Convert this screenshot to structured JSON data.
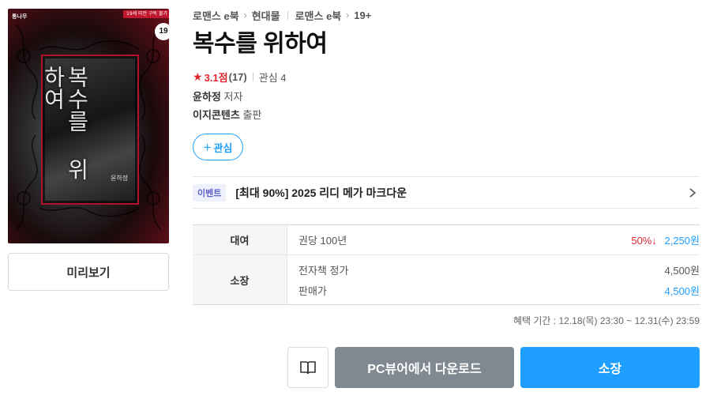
{
  "cover": {
    "title_art": "복수를 위하여",
    "author_art": "윤하정",
    "publisher_mark": "통나무",
    "ribbon": "19세 미만 구독 불가",
    "age_badge": "19"
  },
  "preview_button": "미리보기",
  "breadcrumb": {
    "items": [
      "로맨스 e북",
      "현대물",
      "로맨스 e북",
      "19+"
    ]
  },
  "title": "복수를 위하여",
  "rating": {
    "score": "3.1점",
    "count": "(17)",
    "interest": "관심 4"
  },
  "author": {
    "name": "윤하정",
    "role": "저자"
  },
  "publisher": {
    "name": "이지콘텐츠",
    "role": "출판"
  },
  "follow_button": {
    "plus": "+",
    "label": "관심"
  },
  "event": {
    "badge": "이벤트",
    "text": "[최대 90%] 2025 리디 메가 마크다운"
  },
  "pricing": {
    "rental": {
      "label": "대여",
      "desc": "권당 100년",
      "discount": "50%↓",
      "price": "2,250원"
    },
    "own": {
      "label": "소장",
      "list_label": "전자책 정가",
      "list_price": "4,500원",
      "sale_label": "판매가",
      "sale_price": "4,500원"
    }
  },
  "benefit_period": "혜택 기간 : 12.18(목) 23:30 ~ 12.31(수) 23:59",
  "actions": {
    "download": "PC뷰어에서 다운로드",
    "buy": "소장"
  },
  "colors": {
    "accent": "#1e9eff",
    "discount": "#e0262e",
    "download_bg": "#808991"
  }
}
